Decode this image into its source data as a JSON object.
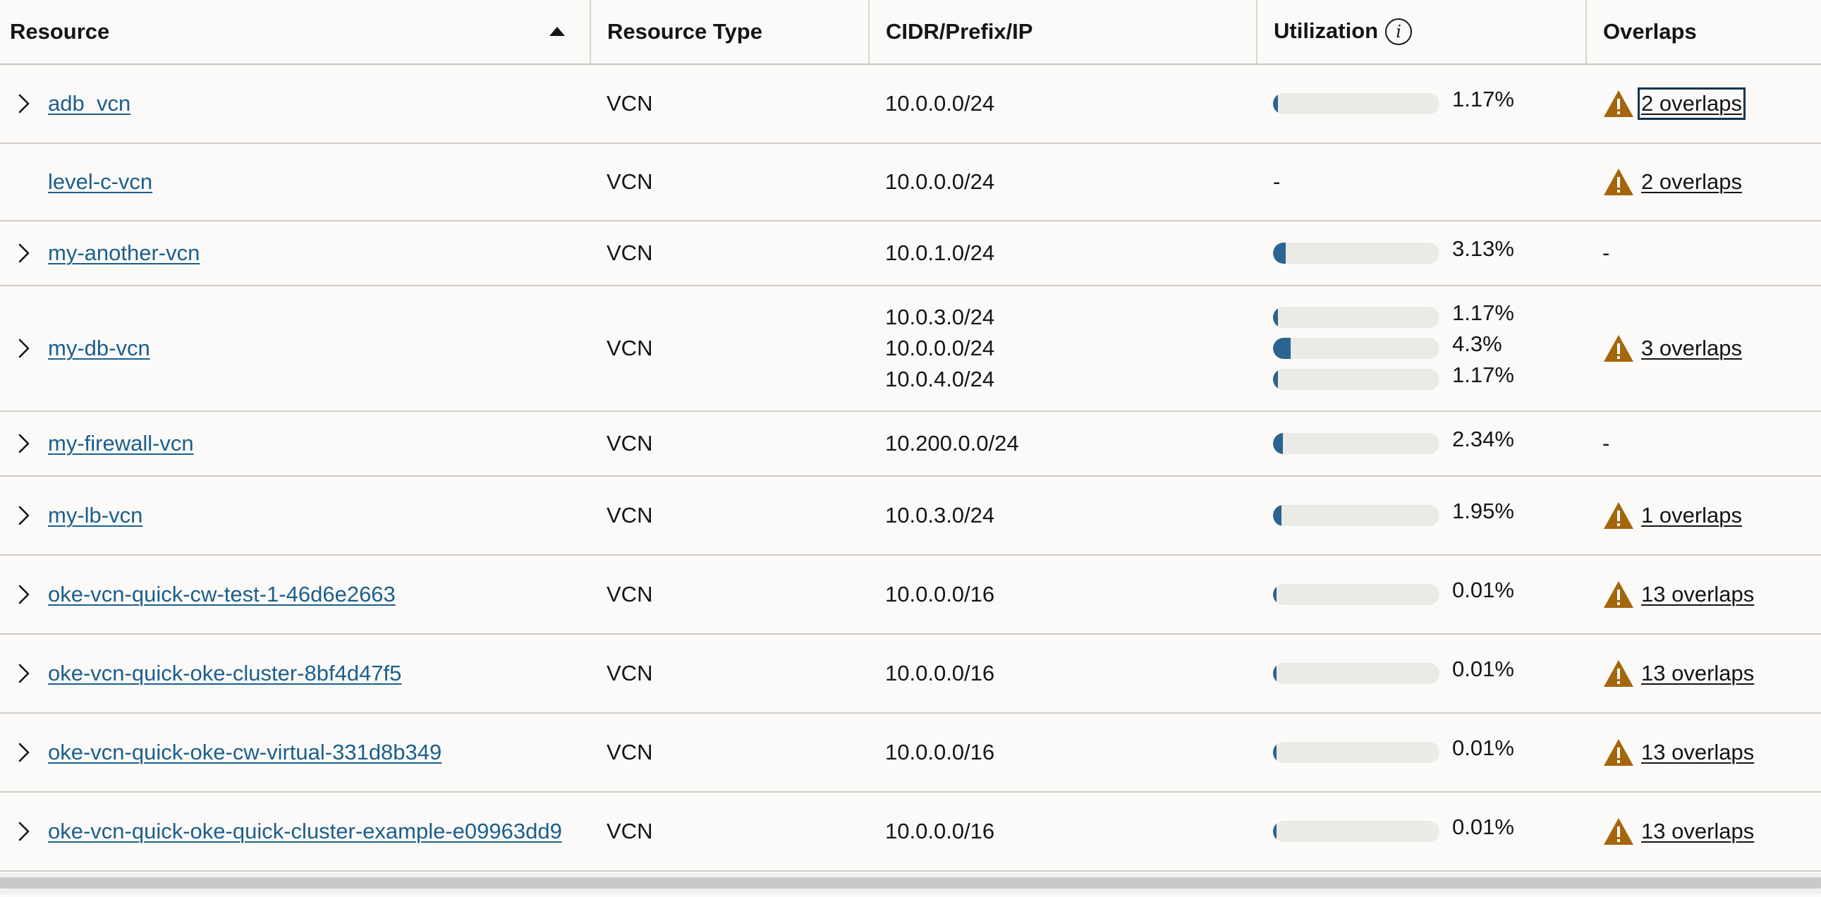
{
  "columns": {
    "resource": "Resource",
    "type": "Resource Type",
    "cidr": "CIDR/Prefix/IP",
    "utilization": "Utilization",
    "overlaps": "Overlaps"
  },
  "colors": {
    "link": "#1c5f8c",
    "bar_fill": "#2b6490",
    "warning": "#a5660b"
  },
  "rows": [
    {
      "name": "adb_vcn",
      "expandable": true,
      "type": "VCN",
      "cidrs": [
        "10.0.0.0/24"
      ],
      "util": [
        {
          "pct": "1.17%",
          "value": 1.17
        }
      ],
      "overlaps": "2 overlaps",
      "focused": true
    },
    {
      "name": "level-c-vcn",
      "expandable": false,
      "type": "VCN",
      "cidrs": [
        "10.0.0.0/24"
      ],
      "util_text": "-",
      "util": [],
      "overlaps": "2 overlaps"
    },
    {
      "name": "my-another-vcn",
      "expandable": true,
      "type": "VCN",
      "cidrs": [
        "10.0.1.0/24"
      ],
      "util": [
        {
          "pct": "3.13%",
          "value": 3.13
        }
      ],
      "overlaps_text": "-"
    },
    {
      "name": "my-db-vcn",
      "expandable": true,
      "type": "VCN",
      "cidrs": [
        "10.0.3.0/24",
        "10.0.0.0/24",
        "10.0.4.0/24"
      ],
      "util": [
        {
          "pct": "1.17%",
          "value": 1.17
        },
        {
          "pct": "4.3%",
          "value": 4.3
        },
        {
          "pct": "1.17%",
          "value": 1.17
        }
      ],
      "overlaps": "3 overlaps"
    },
    {
      "name": "my-firewall-vcn",
      "expandable": true,
      "type": "VCN",
      "cidrs": [
        "10.200.0.0/24"
      ],
      "util": [
        {
          "pct": "2.34%",
          "value": 2.34
        }
      ],
      "overlaps_text": "-"
    },
    {
      "name": "my-lb-vcn",
      "expandable": true,
      "type": "VCN",
      "cidrs": [
        "10.0.3.0/24"
      ],
      "util": [
        {
          "pct": "1.95%",
          "value": 1.95
        }
      ],
      "overlaps": "1 overlaps"
    },
    {
      "name": "oke-vcn-quick-cw-test-1-46d6e2663",
      "expandable": true,
      "type": "VCN",
      "cidrs": [
        "10.0.0.0/16"
      ],
      "util": [
        {
          "pct": "0.01%",
          "value": 0.01
        }
      ],
      "overlaps": "13 overlaps"
    },
    {
      "name": "oke-vcn-quick-oke-cluster-8bf4d47f5",
      "expandable": true,
      "type": "VCN",
      "cidrs": [
        "10.0.0.0/16"
      ],
      "util": [
        {
          "pct": "0.01%",
          "value": 0.01
        }
      ],
      "overlaps": "13 overlaps"
    },
    {
      "name": "oke-vcn-quick-oke-cw-virtual-331d8b349",
      "expandable": true,
      "type": "VCN",
      "cidrs": [
        "10.0.0.0/16"
      ],
      "util": [
        {
          "pct": "0.01%",
          "value": 0.01
        }
      ],
      "overlaps": "13 overlaps"
    },
    {
      "name": "oke-vcn-quick-oke-quick-cluster-example-e09963dd9",
      "expandable": true,
      "type": "VCN",
      "cidrs": [
        "10.0.0.0/16"
      ],
      "util": [
        {
          "pct": "0.01%",
          "value": 0.01
        }
      ],
      "overlaps": "13 overlaps"
    }
  ]
}
